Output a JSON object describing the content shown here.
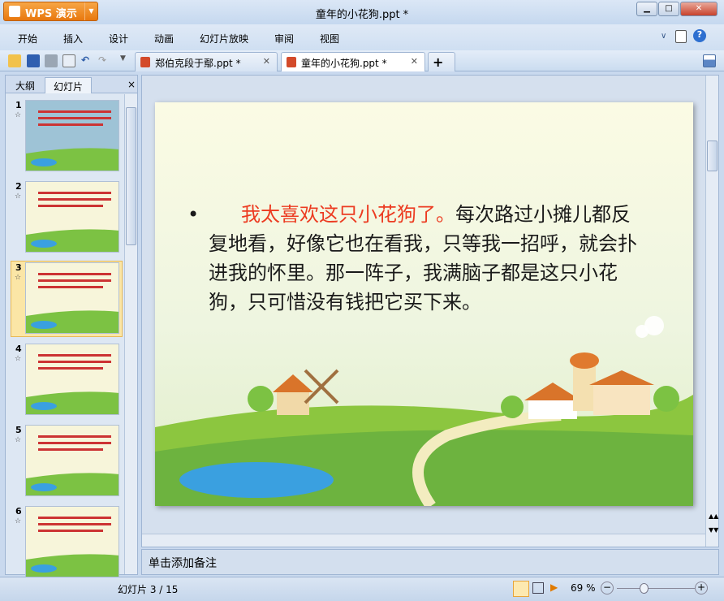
{
  "app": {
    "name": "WPS 演示",
    "title": "童年的小花狗.ppt *"
  },
  "menu": [
    "开始",
    "插入",
    "设计",
    "动画",
    "幻灯片放映",
    "审阅",
    "视图"
  ],
  "doc_tabs": [
    {
      "label": "郑伯克段于鄢.ppt *",
      "active": false
    },
    {
      "label": "童年的小花狗.ppt *",
      "active": true
    }
  ],
  "panel": {
    "tabs": [
      "大纲",
      "幻灯片"
    ],
    "close": "×"
  },
  "thumbnails": [
    {
      "num": "1"
    },
    {
      "num": "2"
    },
    {
      "num": "3"
    },
    {
      "num": "4"
    },
    {
      "num": "5"
    },
    {
      "num": "6"
    }
  ],
  "slide": {
    "bullet": "•",
    "red_text": "我太喜欢这只小花狗了。",
    "body_text": "每次路过小摊儿都反复地看，好像它也在看我，只等我一招呼，就会扑进我的怀里。那一阵子，我满脑子都是这只小花狗，只可惜没有钱把它买下来。",
    "accent_color": "#ec3b21"
  },
  "notes": {
    "placeholder": "单击添加备注"
  },
  "status": {
    "slide_counter": "幻灯片 3 / 15",
    "zoom": "69 %",
    "zoom_level": 0.69
  }
}
